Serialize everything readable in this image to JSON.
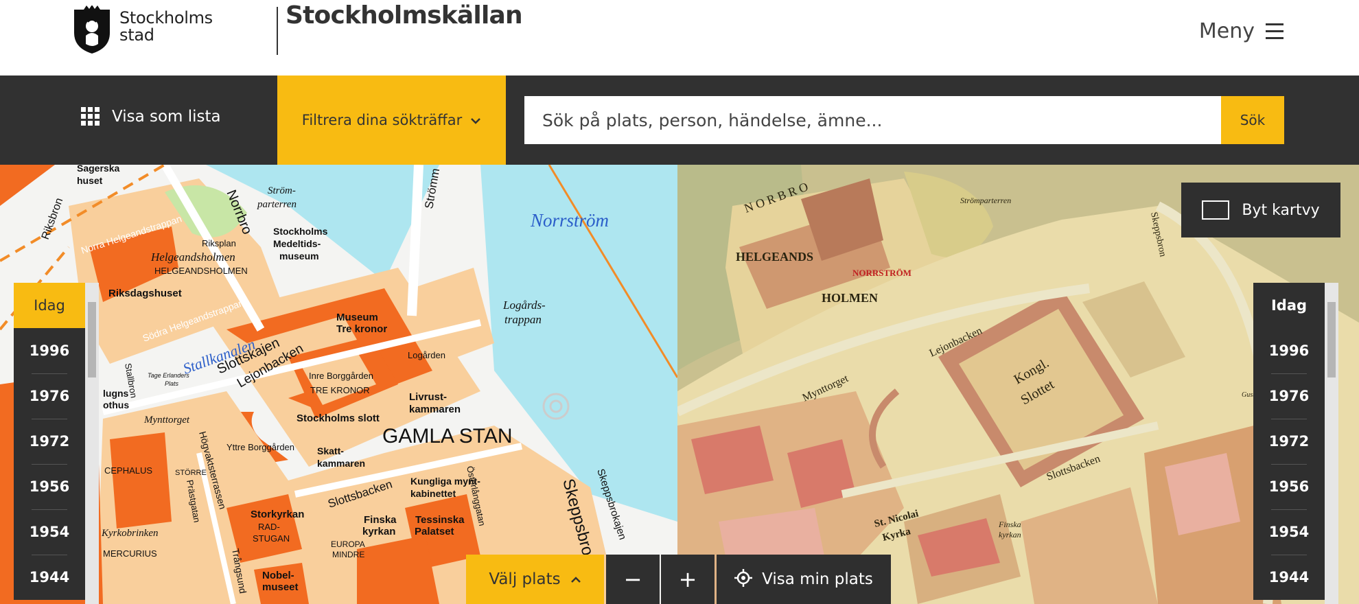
{
  "header": {
    "logo_line1": "Stockholms",
    "logo_line2": "stad",
    "site_title": "Stockholmskällan",
    "menu_label": "Meny"
  },
  "toolbar": {
    "list_label": "Visa som lista",
    "filter_label": "Filtrera dina sökträffar",
    "search_placeholder": "Sök på plats, person, händelse, ämne...",
    "search_button": "Sök"
  },
  "map_left": {
    "labels": {
      "sagerska": "Sagerska",
      "huset": "huset",
      "riksbron": "Riksbron",
      "norrbro": "Norrbro",
      "strom1": "Ström-",
      "strom2": "parterren",
      "strommen": "Strömm",
      "norrstrom": "Norrström",
      "norra_helgeand": "Norra Helgeandstrappan",
      "riksplan": "Riksplan",
      "helgeandsholmen": "Helgeandsholmen",
      "helgeandsholmen_caps": "HELGEANDSHOLMEN",
      "stockholms": "Stockholms",
      "medeltids": "Medeltids-",
      "museum": "museum",
      "riksdagshuset": "Riksdagshuset",
      "sodra_helgeand": "Södra Helgeandstrappan",
      "stallkanalen": "Stallkanalen",
      "logards1": "Logårds-",
      "logards2": "trappan",
      "museum_tre": "Museum",
      "tre_kronor": "Tre kronor",
      "slottskajen": "Slottskajen",
      "lejonbacken": "Lejonbacken",
      "logarden": "Logården",
      "inre": "Inre Borggården",
      "tre_kronor_caps": "TRE KRONOR",
      "livrust1": "Livrust-",
      "livrust2": "kammaren",
      "stockholms_slott": "Stockholms slott",
      "gamla_stan": "GAMLA STAN",
      "yttre": "Yttre Borggården",
      "skatt1": "Skatt-",
      "skatt2": "kammaren",
      "mynttorget": "Mynttorget",
      "hogvakt": "Högvaktsterrassen",
      "stallbron": "Stallbron",
      "slottsbacken": "Slottsbacken",
      "kungliga1": "Kungliga mynt-",
      "kungliga2": "kabinettet",
      "skeppsbron": "Skeppsbron",
      "skeppsbrokajen": "Skeppsbrokajen",
      "storkyrkan": "Storkyrkan",
      "rad": "RAD-",
      "stugan": "STUGAN",
      "finska1": "Finska",
      "finska2": "kyrkan",
      "tessinska1": "Tessinska",
      "tessinska2": "Palatset",
      "nobel1": "Nobel-",
      "nobel2": "museet",
      "europa1": "EUROPA",
      "europa2": "MINDRE",
      "kyrkobrinken": "Kyrkobrinken",
      "cephalus": "CEPHALUS",
      "mercurius": "MERCURIUS",
      "storre": "STÖRRE",
      "tage": "Tage Erlanders",
      "plats": "Plats",
      "praestgatan": "Prästgatan",
      "trangsund": "Trångsund",
      "ostra": "Österlånggatan",
      "lugns": "lugns",
      "othus": "othus"
    }
  },
  "map_right": {
    "labels": {
      "norrbro_v": "N O R B R O",
      "stromparterren": "Strömparterren",
      "helgeandsholmen_caps": "HELGEANDS",
      "holmen": "HOLMEN",
      "norrstrom_red": "NORRSTRÖM",
      "lejonbacken": "Lejonbacken",
      "kongl": "Kongl.",
      "slottet": "Slottet",
      "mynttorget": "Mynttorget",
      "slottsbacken": "Slottsbacken",
      "skeppsbron": "Skeppsbron",
      "st_nicolai": "St. Nicolai",
      "kyrka": "Kyrka",
      "finska": "Finska",
      "kyrkan": "kyrkan",
      "gustaf": "Gustaf III"
    }
  },
  "years": [
    "Idag",
    "1996",
    "1976",
    "1972",
    "1956",
    "1954",
    "1944"
  ],
  "swap_label": "Byt kartvy",
  "controls": {
    "choose_place": "Välj plats",
    "zoom_out": "−",
    "zoom_in": "+",
    "my_location": "Visa min plats"
  },
  "colors": {
    "accent": "#f8bb12",
    "dark": "#313131",
    "water": "#aee6f0",
    "building": "#f26b21",
    "block": "#f9cf9c"
  }
}
